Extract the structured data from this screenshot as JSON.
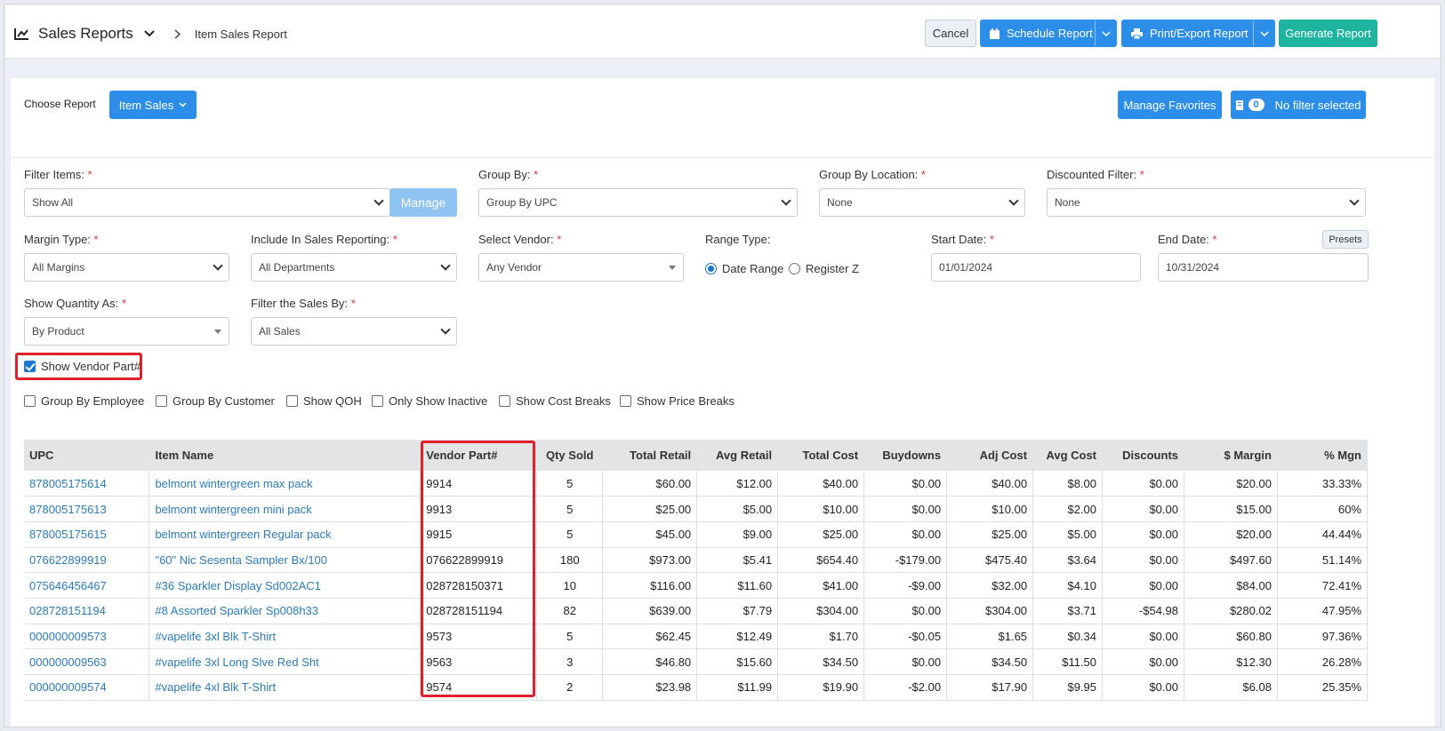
{
  "header": {
    "title": "Sales Reports",
    "breadcrumb": "Item Sales Report",
    "cancel": "Cancel",
    "schedule": "Schedule Report",
    "print": "Print/Export Report",
    "generate": "Generate Report"
  },
  "toolbar": {
    "choose_label": "Choose Report",
    "report_select": "Item Sales",
    "manage_favorites": "Manage Favorites",
    "filter_count": "0",
    "filter_status": "No filter selected"
  },
  "filters": {
    "filter_items": {
      "label": "Filter Items:",
      "value": "Show All",
      "manage": "Manage"
    },
    "group_by": {
      "label": "Group By:",
      "value": "Group By UPC"
    },
    "group_by_location": {
      "label": "Group By Location:",
      "value": "None"
    },
    "discounted_filter": {
      "label": "Discounted Filter:",
      "value": "None"
    },
    "margin_type": {
      "label": "Margin Type:",
      "value": "All Margins"
    },
    "include_in_sales": {
      "label": "Include In Sales Reporting:",
      "value": "All Departments"
    },
    "select_vendor": {
      "label": "Select Vendor:",
      "value": "Any Vendor"
    },
    "range_type": {
      "label": "Range Type:",
      "option1": "Date Range",
      "option2": "Register Z"
    },
    "start_date": {
      "label": "Start Date:",
      "value": "01/01/2024"
    },
    "end_date": {
      "label": "End Date:",
      "value": "10/31/2024",
      "presets": "Presets"
    },
    "show_quantity": {
      "label": "Show Quantity As:",
      "value": "By Product"
    },
    "filter_sales_by": {
      "label": "Filter the Sales By:",
      "value": "All Sales"
    },
    "required_mark": "*"
  },
  "checkboxes": {
    "show_vendor_part": "Show Vendor Part#",
    "group_by_employee": "Group By Employee",
    "group_by_customer": "Group By Customer",
    "show_qoh": "Show QOH",
    "only_inactive": "Only Show Inactive",
    "show_cost_breaks": "Show Cost Breaks",
    "show_price_breaks": "Show Price Breaks"
  },
  "table": {
    "headers": [
      "UPC",
      "Item Name",
      "Vendor Part#",
      "Qty Sold",
      "Total Retail",
      "Avg Retail",
      "Total Cost",
      "Buydowns",
      "Adj Cost",
      "Avg Cost",
      "Discounts",
      "$ Margin",
      "% Mgn"
    ],
    "rows": [
      [
        "878005175614",
        "belmont wintergreen max pack",
        "9914",
        "5",
        "$60.00",
        "$12.00",
        "$40.00",
        "$0.00",
        "$40.00",
        "$8.00",
        "$0.00",
        "$20.00",
        "33.33%"
      ],
      [
        "878005175613",
        "belmont wintergreen mini pack",
        "9913",
        "5",
        "$25.00",
        "$5.00",
        "$10.00",
        "$0.00",
        "$10.00",
        "$2.00",
        "$0.00",
        "$15.00",
        "60%"
      ],
      [
        "878005175615",
        "belmont wintergreen Regular pack",
        "9915",
        "5",
        "$45.00",
        "$9.00",
        "$25.00",
        "$0.00",
        "$25.00",
        "$5.00",
        "$0.00",
        "$20.00",
        "44.44%"
      ],
      [
        "076622899919",
        "\"60\" Nic Sesenta Sampler Bx/100",
        "076622899919",
        "180",
        "$973.00",
        "$5.41",
        "$654.40",
        "-$179.00",
        "$475.40",
        "$3.64",
        "$0.00",
        "$497.60",
        "51.14%"
      ],
      [
        "075646456467",
        "#36 Sparkler Display Sd002AC1",
        "028728150371",
        "10",
        "$116.00",
        "$11.60",
        "$41.00",
        "-$9.00",
        "$32.00",
        "$4.10",
        "$0.00",
        "$84.00",
        "72.41%"
      ],
      [
        "028728151194",
        "#8 Assorted Sparkler Sp008h33",
        "028728151194",
        "82",
        "$639.00",
        "$7.79",
        "$304.00",
        "$0.00",
        "$304.00",
        "$3.71",
        "-$54.98",
        "$280.02",
        "47.95%"
      ],
      [
        "000000009573",
        "#vapelife 3xl Blk T-Shirt",
        "9573",
        "5",
        "$62.45",
        "$12.49",
        "$1.70",
        "-$0.05",
        "$1.65",
        "$0.34",
        "$0.00",
        "$60.80",
        "97.36%"
      ],
      [
        "000000009563",
        "#vapelife 3xl Long Slve Red Sht",
        "9563",
        "3",
        "$46.80",
        "$15.60",
        "$34.50",
        "$0.00",
        "$34.50",
        "$11.50",
        "$0.00",
        "$12.30",
        "26.28%"
      ],
      [
        "000000009574",
        "#vapelife 4xl Blk T-Shirt",
        "9574",
        "2",
        "$23.98",
        "$11.99",
        "$19.90",
        "-$2.00",
        "$17.90",
        "$9.95",
        "$0.00",
        "$6.08",
        "25.35%"
      ]
    ]
  },
  "colors": {
    "primary": "#2d8ee9",
    "teal": "#1fb4a0",
    "highlight": "#e0202a",
    "link": "#2b7bbd"
  }
}
